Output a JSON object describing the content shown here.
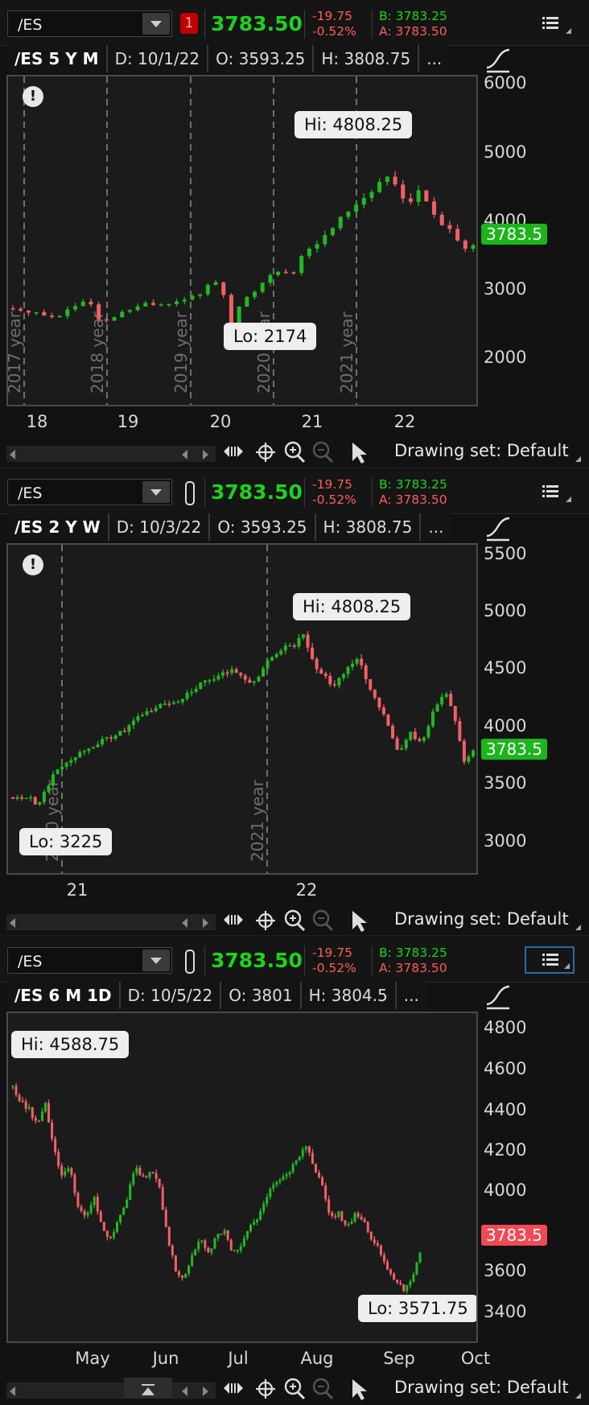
{
  "colors": {
    "up": "#22b822",
    "down": "#f25f67",
    "price_green": "#1cd31c",
    "price_red": "#f04a55",
    "grid": "#8c8c8c"
  },
  "panes": [
    {
      "symbol": "/ES",
      "badge": "1",
      "last": "3783.50",
      "change": "-19.75",
      "change_pct": "-0.52%",
      "bid": "B: 3783.25",
      "ask": "A: 3783.50",
      "info": [
        "/ES 5 Y M",
        "D: 10/1/22",
        "O: 3593.25",
        "H: 3808.75",
        "..."
      ],
      "y_labels": [
        "6000",
        "5000",
        "4000",
        "3000",
        "2000"
      ],
      "price_tag": "3783.5",
      "x_labels": [
        "18",
        "19",
        "20",
        "21",
        "22"
      ],
      "year_labels": [
        "2017 year",
        "2018 year",
        "2019 year",
        "2020 year",
        "2021 year"
      ],
      "hi_label": "Hi: 4808.25",
      "lo_label": "Lo: 2174",
      "drawing_set": "Drawing set: Default"
    },
    {
      "symbol": "/ES",
      "last": "3783.50",
      "change": "-19.75",
      "change_pct": "-0.52%",
      "bid": "B: 3783.25",
      "ask": "A: 3783.50",
      "info": [
        "/ES 2 Y W",
        "D: 10/3/22",
        "O: 3593.25",
        "H: 3808.75",
        "..."
      ],
      "y_labels": [
        "5500",
        "5000",
        "4500",
        "4000",
        "3500",
        "3000"
      ],
      "price_tag": "3783.5",
      "x_labels": [
        "21",
        "22"
      ],
      "year_labels": [
        "2020 year",
        "2021 year"
      ],
      "hi_label": "Hi: 4808.25",
      "lo_label": "Lo: 3225",
      "drawing_set": "Drawing set: Default"
    },
    {
      "symbol": "/ES",
      "last": "3783.50",
      "change": "-19.75",
      "change_pct": "-0.52%",
      "bid": "B: 3783.25",
      "ask": "A: 3783.50",
      "info": [
        "/ES 6 M 1D",
        "D: 10/5/22",
        "O: 3801",
        "H: 3804.5",
        "..."
      ],
      "y_labels": [
        "4800",
        "4600",
        "4400",
        "4200",
        "4000",
        "3800",
        "3600",
        "3400"
      ],
      "price_tag": "3783.5",
      "x_labels": [
        "May",
        "Jun",
        "Jul",
        "Aug",
        "Sep",
        "Oct"
      ],
      "hi_label": "Hi: 4588.75",
      "lo_label": "Lo: 3571.75",
      "drawing_set": "Drawing set: Default"
    }
  ],
  "chart_data": [
    {
      "type": "candlestick",
      "title": "/ES 5 Y M",
      "ylim": [
        1500,
        6200
      ],
      "x": [
        "18",
        "19",
        "20",
        "21",
        "22"
      ],
      "path": [
        [
          0,
          2880
        ],
        [
          0.02,
          2820
        ],
        [
          0.04,
          2860
        ],
        [
          0.06,
          2800
        ],
        [
          0.08,
          2740
        ],
        [
          0.1,
          2780
        ],
        [
          0.12,
          2860
        ],
        [
          0.14,
          2930
        ],
        [
          0.16,
          2960
        ],
        [
          0.18,
          2900
        ],
        [
          0.19,
          2600
        ],
        [
          0.21,
          2720
        ],
        [
          0.23,
          2790
        ],
        [
          0.25,
          2850
        ],
        [
          0.27,
          2900
        ],
        [
          0.29,
          2940
        ],
        [
          0.31,
          2920
        ],
        [
          0.33,
          2980
        ],
        [
          0.35,
          2950
        ],
        [
          0.37,
          3000
        ],
        [
          0.39,
          3040
        ],
        [
          0.41,
          3120
        ],
        [
          0.43,
          3230
        ],
        [
          0.45,
          3300
        ],
        [
          0.46,
          2960
        ],
        [
          0.47,
          2560
        ],
        [
          0.49,
          2880
        ],
        [
          0.51,
          3050
        ],
        [
          0.53,
          3150
        ],
        [
          0.55,
          3320
        ],
        [
          0.57,
          3450
        ],
        [
          0.59,
          3400
        ],
        [
          0.61,
          3350
        ],
        [
          0.63,
          3650
        ],
        [
          0.65,
          3780
        ],
        [
          0.67,
          3850
        ],
        [
          0.69,
          4000
        ],
        [
          0.71,
          4200
        ],
        [
          0.73,
          4300
        ],
        [
          0.75,
          4400
        ],
        [
          0.77,
          4530
        ],
        [
          0.79,
          4600
        ],
        [
          0.81,
          4750
        ],
        [
          0.82,
          4800
        ],
        [
          0.84,
          4530
        ],
        [
          0.86,
          4400
        ],
        [
          0.88,
          4550
        ],
        [
          0.9,
          4400
        ],
        [
          0.92,
          4150
        ],
        [
          0.94,
          4000
        ],
        [
          0.96,
          3950
        ],
        [
          0.98,
          3750
        ],
        [
          1.0,
          3783
        ]
      ]
    },
    {
      "type": "candlestick",
      "title": "/ES 2 Y W",
      "ylim": [
        2700,
        5600
      ],
      "x": [
        "21",
        "22"
      ],
      "path": [
        [
          0,
          3370
        ],
        [
          0.04,
          3380
        ],
        [
          0.05,
          3280
        ],
        [
          0.07,
          3420
        ],
        [
          0.09,
          3600
        ],
        [
          0.12,
          3700
        ],
        [
          0.16,
          3800
        ],
        [
          0.2,
          3880
        ],
        [
          0.24,
          3950
        ],
        [
          0.28,
          4100
        ],
        [
          0.32,
          4180
        ],
        [
          0.36,
          4230
        ],
        [
          0.4,
          4350
        ],
        [
          0.44,
          4420
        ],
        [
          0.48,
          4500
        ],
        [
          0.5,
          4450
        ],
        [
          0.52,
          4350
        ],
        [
          0.55,
          4550
        ],
        [
          0.58,
          4680
        ],
        [
          0.61,
          4700
        ],
        [
          0.63,
          4808
        ],
        [
          0.65,
          4600
        ],
        [
          0.67,
          4450
        ],
        [
          0.7,
          4350
        ],
        [
          0.73,
          4550
        ],
        [
          0.75,
          4600
        ],
        [
          0.78,
          4300
        ],
        [
          0.8,
          4150
        ],
        [
          0.82,
          3950
        ],
        [
          0.84,
          3750
        ],
        [
          0.86,
          3950
        ],
        [
          0.88,
          3850
        ],
        [
          0.9,
          3950
        ],
        [
          0.92,
          4200
        ],
        [
          0.94,
          4300
        ],
        [
          0.96,
          4050
        ],
        [
          0.98,
          3700
        ],
        [
          1.0,
          3783
        ]
      ]
    },
    {
      "type": "candlestick",
      "title": "/ES 6 M 1D",
      "ylim": [
        3350,
        4950
      ],
      "x": [
        "May",
        "Jun",
        "Jul",
        "Aug",
        "Sep",
        "Oct"
      ],
      "path": [
        [
          0,
          4588
        ],
        [
          0.02,
          4520
        ],
        [
          0.04,
          4480
        ],
        [
          0.06,
          4400
        ],
        [
          0.08,
          4500
        ],
        [
          0.1,
          4300
        ],
        [
          0.12,
          4150
        ],
        [
          0.14,
          4200
        ],
        [
          0.16,
          4000
        ],
        [
          0.18,
          3950
        ],
        [
          0.2,
          4050
        ],
        [
          0.22,
          3900
        ],
        [
          0.24,
          3850
        ],
        [
          0.26,
          3950
        ],
        [
          0.28,
          4050
        ],
        [
          0.3,
          4200
        ],
        [
          0.32,
          4150
        ],
        [
          0.34,
          4180
        ],
        [
          0.36,
          4100
        ],
        [
          0.38,
          3850
        ],
        [
          0.4,
          3700
        ],
        [
          0.42,
          3650
        ],
        [
          0.44,
          3780
        ],
        [
          0.46,
          3850
        ],
        [
          0.48,
          3780
        ],
        [
          0.5,
          3860
        ],
        [
          0.52,
          3900
        ],
        [
          0.54,
          3780
        ],
        [
          0.56,
          3820
        ],
        [
          0.58,
          3900
        ],
        [
          0.6,
          3950
        ],
        [
          0.62,
          4050
        ],
        [
          0.64,
          4120
        ],
        [
          0.66,
          4150
        ],
        [
          0.68,
          4180
        ],
        [
          0.7,
          4250
        ],
        [
          0.72,
          4300
        ],
        [
          0.74,
          4200
        ],
        [
          0.76,
          4100
        ],
        [
          0.78,
          3950
        ],
        [
          0.8,
          3980
        ],
        [
          0.82,
          3900
        ],
        [
          0.84,
          3970
        ],
        [
          0.86,
          3950
        ],
        [
          0.88,
          3850
        ],
        [
          0.9,
          3800
        ],
        [
          0.92,
          3700
        ],
        [
          0.94,
          3650
        ],
        [
          0.96,
          3600
        ],
        [
          0.98,
          3650
        ],
        [
          1.0,
          3783
        ]
      ]
    }
  ]
}
